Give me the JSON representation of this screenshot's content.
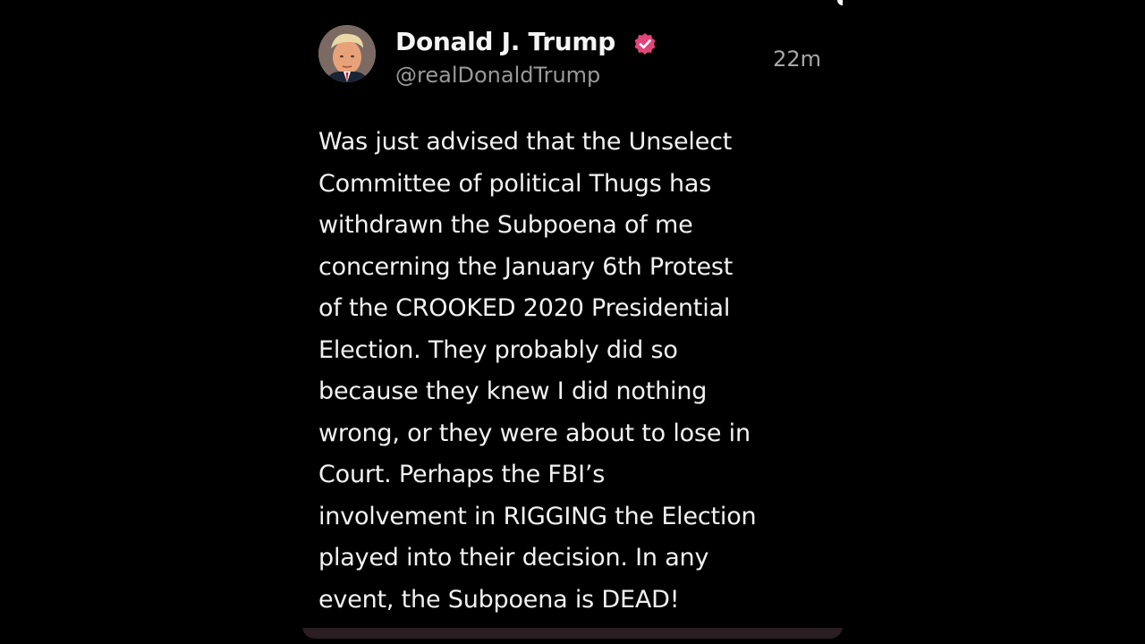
{
  "post": {
    "author_name": "Donald J. Trump",
    "handle": "@realDonaldTrump",
    "timestamp": "22m",
    "verified_icon": "verified-badge-icon",
    "body_lines": [
      "Was just advised that the Unselect",
      "Committee of political Thugs has",
      "withdrawn the Subpoena of me",
      "concerning the January 6th Protest",
      "of the CROOKED 2020 Presidential",
      "Election. They probably did so",
      "because they knew I did nothing",
      "wrong, or they were about to lose in",
      "Court. Perhaps the FBI’s",
      "involvement in RIGGING the Election",
      "played into their decision. In any",
      "event, the Subpoena is DEAD!"
    ]
  },
  "colors": {
    "background": "#000000",
    "name_text": "#f4f4f4",
    "handle_text": "#9a9a9a",
    "body_text": "#f2f2f2",
    "verified_badge": "#e2457a"
  }
}
